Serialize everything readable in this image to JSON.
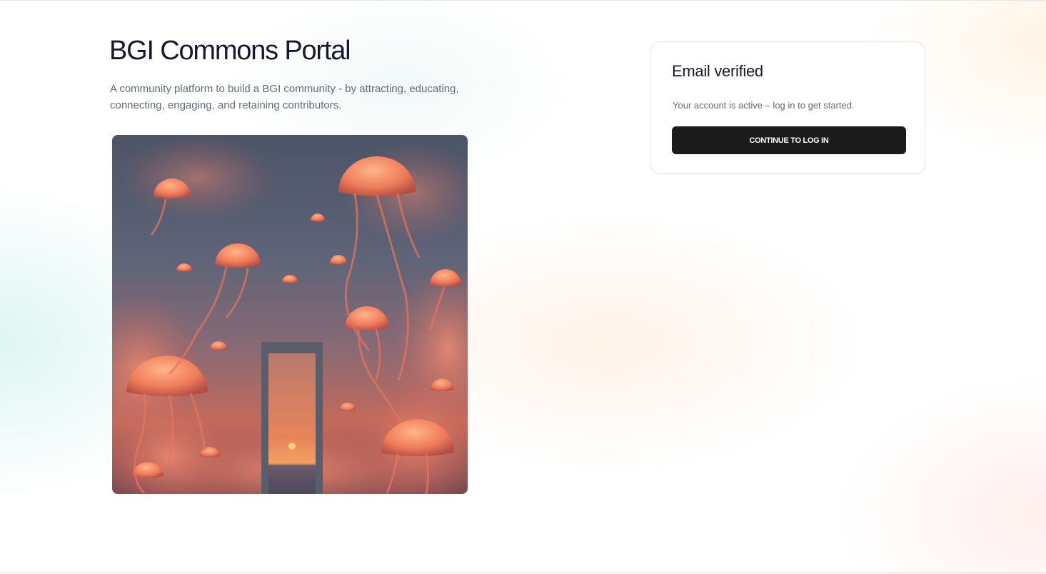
{
  "page": {
    "title": "BGI Commons Portal",
    "subtitle": "A community platform to build a BGI community - by attracting, educating, connecting, engaging, and retaining contributors."
  },
  "hero_image": {
    "description": "jellyfish-sky-doorway-artwork"
  },
  "verify_card": {
    "title": "Email verified",
    "message": "Your account is active – log in to get started.",
    "button_label": "CONTINUE TO LOG IN",
    "button_color": "#1b1b1b"
  },
  "colors": {
    "heading": "#1b1733",
    "body_text": "#5d6b82",
    "card_border": "#e3e4ea"
  }
}
